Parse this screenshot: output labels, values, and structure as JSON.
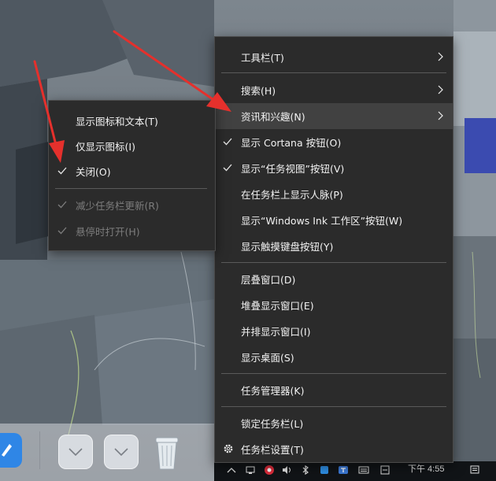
{
  "main_menu": {
    "items": [
      {
        "label": "工具栏(T)",
        "submenu": true
      },
      {
        "label": "搜索(H)",
        "submenu": true
      },
      {
        "label": "资讯和兴趣(N)",
        "submenu": true,
        "highlighted": true
      },
      {
        "label": "显示 Cortana 按钮(O)",
        "checked": true
      },
      {
        "label": "显示“任务视图”按钮(V)",
        "checked": true
      },
      {
        "label": "在任务栏上显示人脉(P)"
      },
      {
        "label": "显示“Windows Ink 工作区”按钮(W)"
      },
      {
        "label": "显示触摸键盘按钮(Y)"
      },
      {
        "label": "层叠窗口(D)"
      },
      {
        "label": "堆叠显示窗口(E)"
      },
      {
        "label": "并排显示窗口(I)"
      },
      {
        "label": "显示桌面(S)"
      },
      {
        "label": "任务管理器(K)"
      },
      {
        "label": "锁定任务栏(L)"
      },
      {
        "label": "任务栏设置(T)",
        "icon": "gear-icon"
      }
    ]
  },
  "sub_menu": {
    "items": [
      {
        "label": "显示图标和文本(T)"
      },
      {
        "label": "仅显示图标(I)"
      },
      {
        "label": "关闭(O)",
        "checked": true
      },
      {
        "label": "减少任务栏更新(R)",
        "checked": true,
        "disabled": true
      },
      {
        "label": "悬停时打开(H)",
        "checked": true,
        "disabled": true
      }
    ]
  },
  "taskbar": {
    "clock": "下午 4:55",
    "tray_icons": [
      "chevron-up-icon",
      "network-icon",
      "security-icon",
      "volume-icon",
      "bluetooth-icon",
      "app-icon",
      "input-method-icon",
      "keyboard-icon",
      "notification-icon"
    ]
  },
  "dock": {
    "icons": [
      "app-icon",
      "chevron-down-icon",
      "chevron-down-icon",
      "trash-icon"
    ]
  },
  "annotation": {
    "arrow_color": "#e5302c"
  }
}
